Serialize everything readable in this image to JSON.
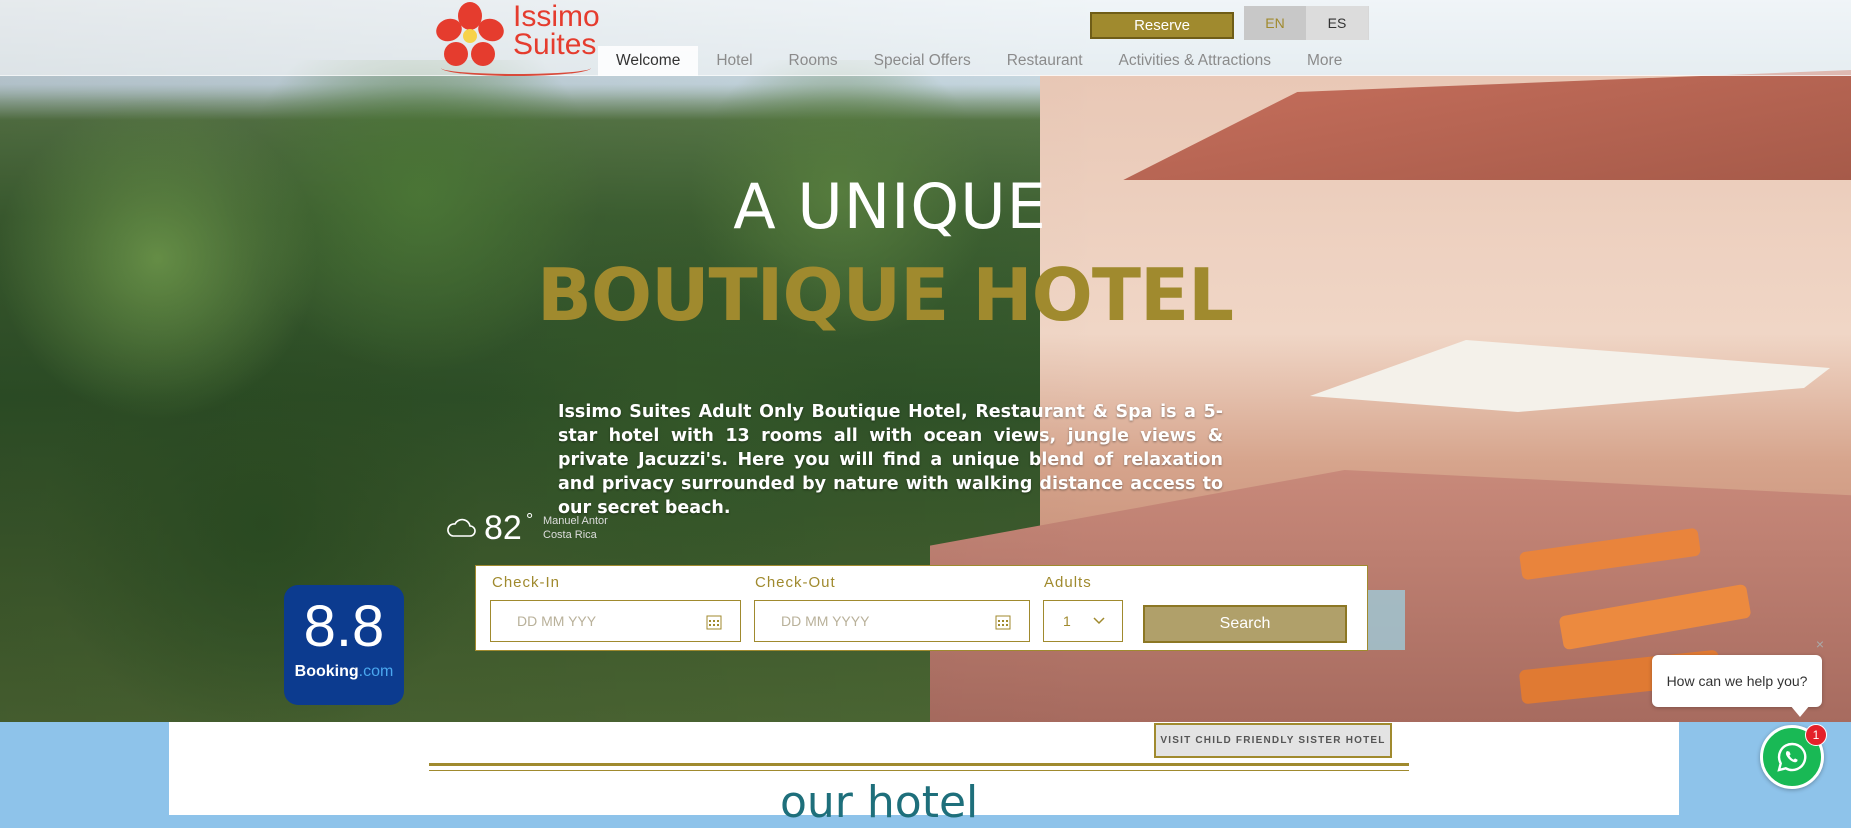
{
  "brand": {
    "line1": "Issimo",
    "line2": "Suites"
  },
  "nav": {
    "items": [
      "Welcome",
      "Hotel",
      "Rooms",
      "Special Offers",
      "Restaurant",
      "Activities & Attractions",
      "More"
    ],
    "active": "Welcome"
  },
  "header": {
    "reserve_label": "Reserve",
    "languages": [
      "EN",
      "ES"
    ],
    "selected_language": "EN"
  },
  "hero": {
    "headline_1": "A UNIQUE",
    "headline_2": "BOUTIQUE HOTEL",
    "intro": "Issimo Suites Adult Only Boutique Hotel, Restaurant & Spa is a 5-star hotel with 13 rooms all with ocean views, jungle views & private Jacuzzi's. Here you will find a unique blend of relaxation and privacy surrounded by nature with walking distance access to our secret beach."
  },
  "weather": {
    "temperature": "82",
    "degree": "°",
    "place_line1": "Manuel Antor",
    "place_line2": "Costa Rica",
    "icon": "cloud-icon"
  },
  "rating": {
    "score": "8.8",
    "brand": "Booking",
    "brand_suffix": ".com"
  },
  "booking_widget": {
    "checkin_label": "Check-In",
    "checkin_placeholder": "DD MM YYY",
    "checkout_label": "Check-Out",
    "checkout_placeholder": "DD MM YYYY",
    "adults_label": "Adults",
    "adults_value": "1",
    "search_label": "Search"
  },
  "below_fold": {
    "sister_button": "VISIT CHILD FRIENDLY SISTER HOTEL",
    "section_title": "our hotel"
  },
  "chat": {
    "prompt": "How can we help you?",
    "close": "×",
    "unread": "1"
  },
  "colors": {
    "gold": "#a08a2e",
    "booking_blue": "#0c3b8f",
    "whatsapp": "#19b955",
    "logo_red": "#e53c2e"
  }
}
